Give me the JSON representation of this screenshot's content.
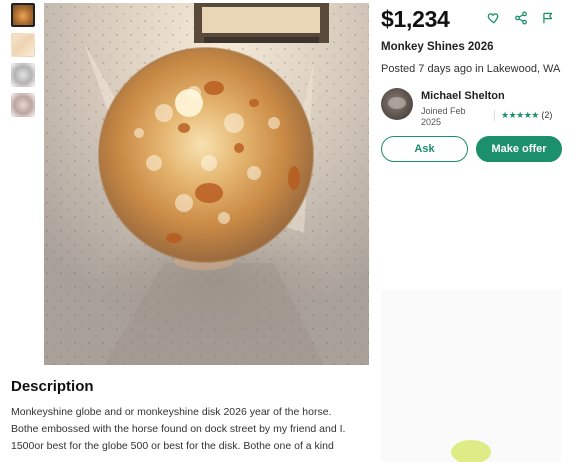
{
  "listing": {
    "price": "$1,234",
    "title": "Monkey Shines 2026",
    "posted": "Posted 7 days ago in Lakewood, WA"
  },
  "icons": {
    "favorite": "heart-icon",
    "share": "share-icon",
    "report": "flag-icon"
  },
  "seller": {
    "name": "Michael Shelton",
    "joined": "Joined Feb 2025",
    "stars": "★★★★★",
    "rating_count": "(2)",
    "rating_value": 5
  },
  "actions": {
    "ask_label": "Ask",
    "offer_label": "Make offer"
  },
  "gallery": {
    "thumbnail_count": 4,
    "active_index": 0
  },
  "description": {
    "heading": "Description",
    "body": "Monkeyshine globe and or monkeyshine disk 2026 year of the horse. Bothe embossed with the horse found on dock street by my friend and I. 1500or best for the globe 500 or best for the disk. Bothe one of a kind"
  },
  "colors": {
    "accent": "#1c8f6b",
    "text": "#222222"
  }
}
